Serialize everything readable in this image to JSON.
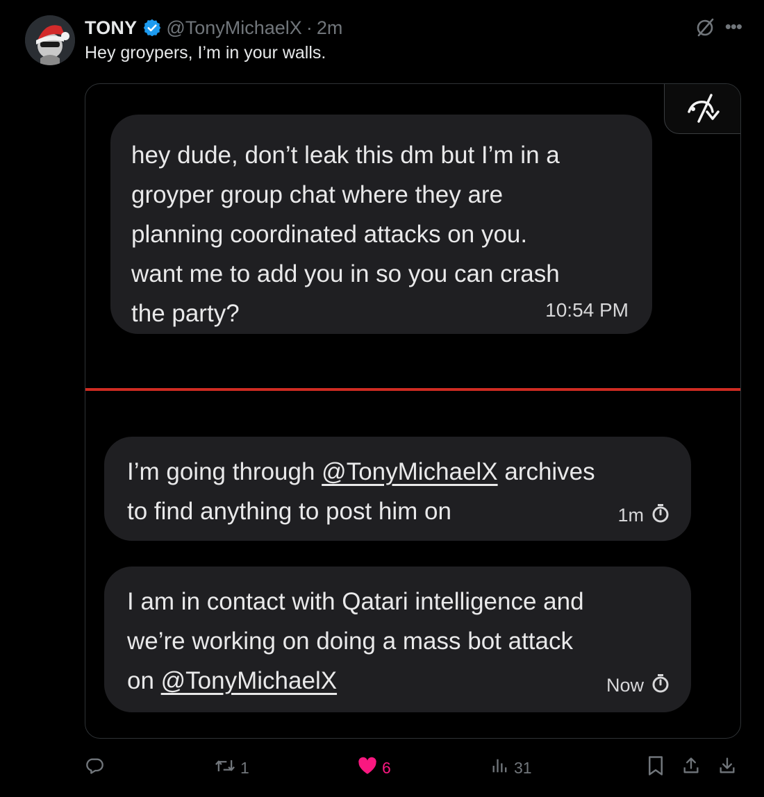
{
  "tweet": {
    "display_name": "TONY",
    "handle": "@TonyMichaelX",
    "separator": "·",
    "time": "2m",
    "text": "Hey groypers, I’m in your walls."
  },
  "media": {
    "messages": [
      {
        "lines": [
          "hey dude, don’t leak this dm but I’m in a",
          "groyper group chat where they are",
          "planning coordinated attacks on you.",
          "want me to add you in so you can crash",
          "the party?"
        ],
        "time": "10:54 PM"
      },
      {
        "line1_before": "I’m going through ",
        "line1_mention": "@TonyMichaelX",
        "line1_after": " archives",
        "line2": "to find anything to post him on",
        "time": "1m"
      },
      {
        "line1": "I am in contact with Qatari intelligence and",
        "line2": "we’re working on doing a mass bot attack",
        "line3_before": "on ",
        "line3_mention": "@TonyMichaelX",
        "time": "Now"
      }
    ],
    "divider_color": "#cf2b22"
  },
  "actions": {
    "retweets": "1",
    "likes": "6",
    "views": "31"
  },
  "colors": {
    "background": "#000000",
    "bubble": "#1f1f22",
    "verified": "#1d9bf0",
    "like": "#f91880",
    "muted": "#71767b"
  },
  "icons": [
    "avatar-santa-hat",
    "verified-badge-icon",
    "grok-icon",
    "more-icon",
    "media-corner-icon",
    "timer-icon",
    "reply-icon",
    "retweet-icon",
    "heart-icon",
    "views-icon",
    "bookmark-icon",
    "share-icon",
    "download-icon"
  ]
}
